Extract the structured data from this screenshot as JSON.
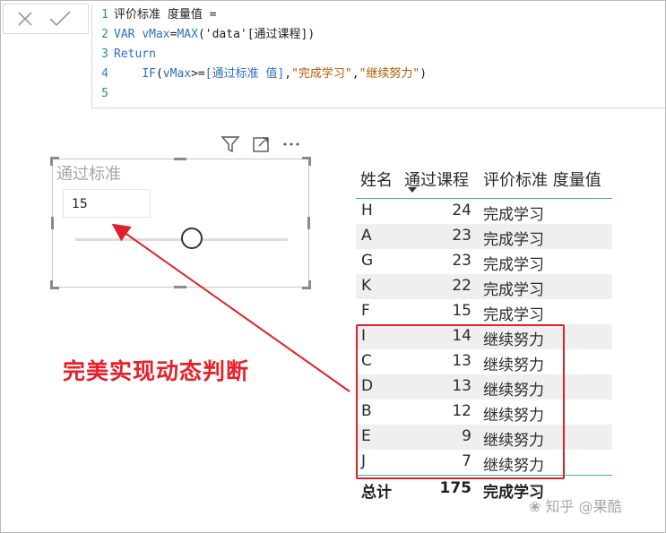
{
  "formula_bar": {
    "cancel_icon": "close-icon",
    "commit_icon": "checkmark-icon",
    "lines": [
      {
        "no": "1",
        "text": "评价标准 度量值 ="
      },
      {
        "no": "2",
        "kw": "VAR ",
        "var": "vMax",
        "eq": "=",
        "fn": "MAX",
        "open": "(",
        "tbl": "'data'",
        "colref": "[通过课程]",
        "close": ")"
      },
      {
        "no": "3",
        "kw": "Return"
      },
      {
        "no": "4",
        "indent": "    ",
        "fn": "IF",
        "open": "(",
        "var": "vMax",
        "op": ">=",
        "colref": "[通过标准 值]",
        "sep1": ",",
        "s1": "\"完成学习\"",
        "sep2": ",",
        "s2": "\"继续努力\"",
        "close": ")"
      },
      {
        "no": "5"
      }
    ]
  },
  "visual_header_icons": [
    "filter-icon",
    "focus-mode-icon",
    "more-options-icon"
  ],
  "slicer": {
    "title": "通过标准",
    "value": "15",
    "slider_fraction": 0.55
  },
  "annotation": {
    "text": "完美实现动态判断"
  },
  "table": {
    "headers": [
      "姓名",
      "通过课程",
      "评价标准 度量值"
    ],
    "rows": [
      {
        "name": "H",
        "courses": "24",
        "eval": "完成学习"
      },
      {
        "name": "A",
        "courses": "23",
        "eval": "完成学习"
      },
      {
        "name": "G",
        "courses": "23",
        "eval": "完成学习"
      },
      {
        "name": "K",
        "courses": "22",
        "eval": "完成学习"
      },
      {
        "name": "F",
        "courses": "15",
        "eval": "完成学习"
      },
      {
        "name": "I",
        "courses": "14",
        "eval": "继续努力"
      },
      {
        "name": "C",
        "courses": "13",
        "eval": "继续努力"
      },
      {
        "name": "D",
        "courses": "13",
        "eval": "继续努力"
      },
      {
        "name": "B",
        "courses": "12",
        "eval": "继续努力"
      },
      {
        "name": "E",
        "courses": "9",
        "eval": "继续努力"
      },
      {
        "name": "J",
        "courses": "7",
        "eval": "继续努力"
      }
    ],
    "totals": {
      "name": "总计",
      "courses": "175",
      "eval": "完成学习"
    }
  },
  "watermark": {
    "text": "知乎 @果酷"
  },
  "colors": {
    "accent_teal": "#39b4a6",
    "annotation_red": "#e0202a",
    "keyword_blue": "#2d6fc0"
  }
}
